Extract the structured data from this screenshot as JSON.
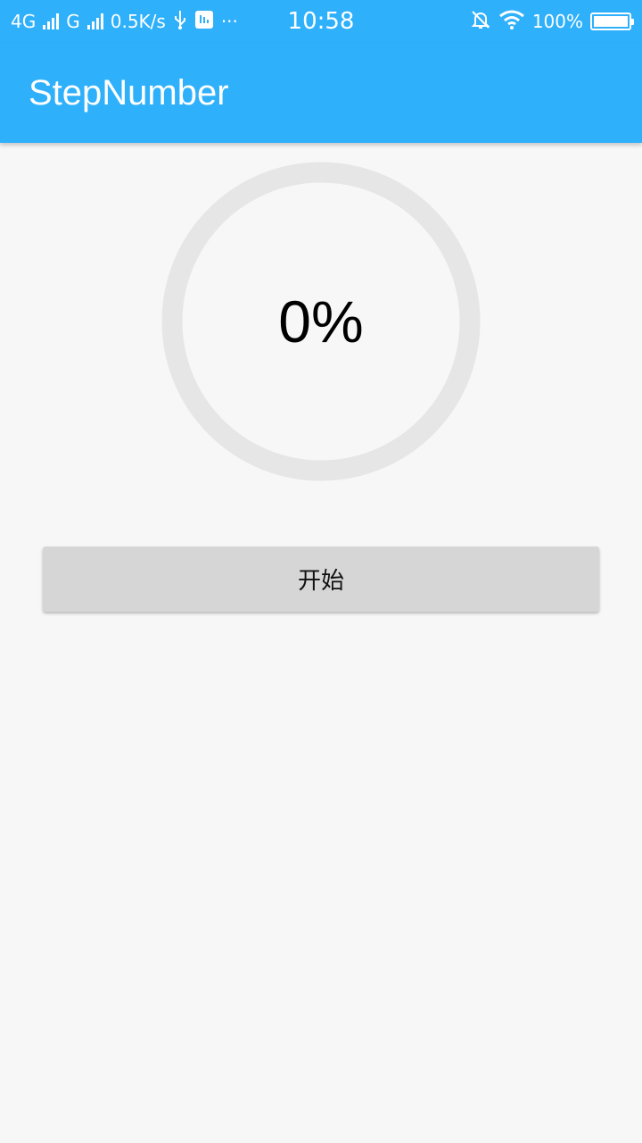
{
  "status_bar": {
    "network_1": "4G",
    "network_2": "G",
    "speed": "0.5K/s",
    "more": "···",
    "time": "10:58",
    "battery": "100%",
    "battery_level": 1.0,
    "icons": [
      "signal-icon",
      "usb-icon",
      "notification-icon",
      "bell-off-icon",
      "wifi-icon",
      "battery-icon"
    ]
  },
  "app_bar": {
    "title": "StepNumber",
    "color": "#2fb0fb"
  },
  "progress": {
    "text": "0%",
    "value": 0,
    "track_color": "#e6e6e6",
    "progress_color": "#2fb0fb"
  },
  "start_button": {
    "label": "开始"
  }
}
